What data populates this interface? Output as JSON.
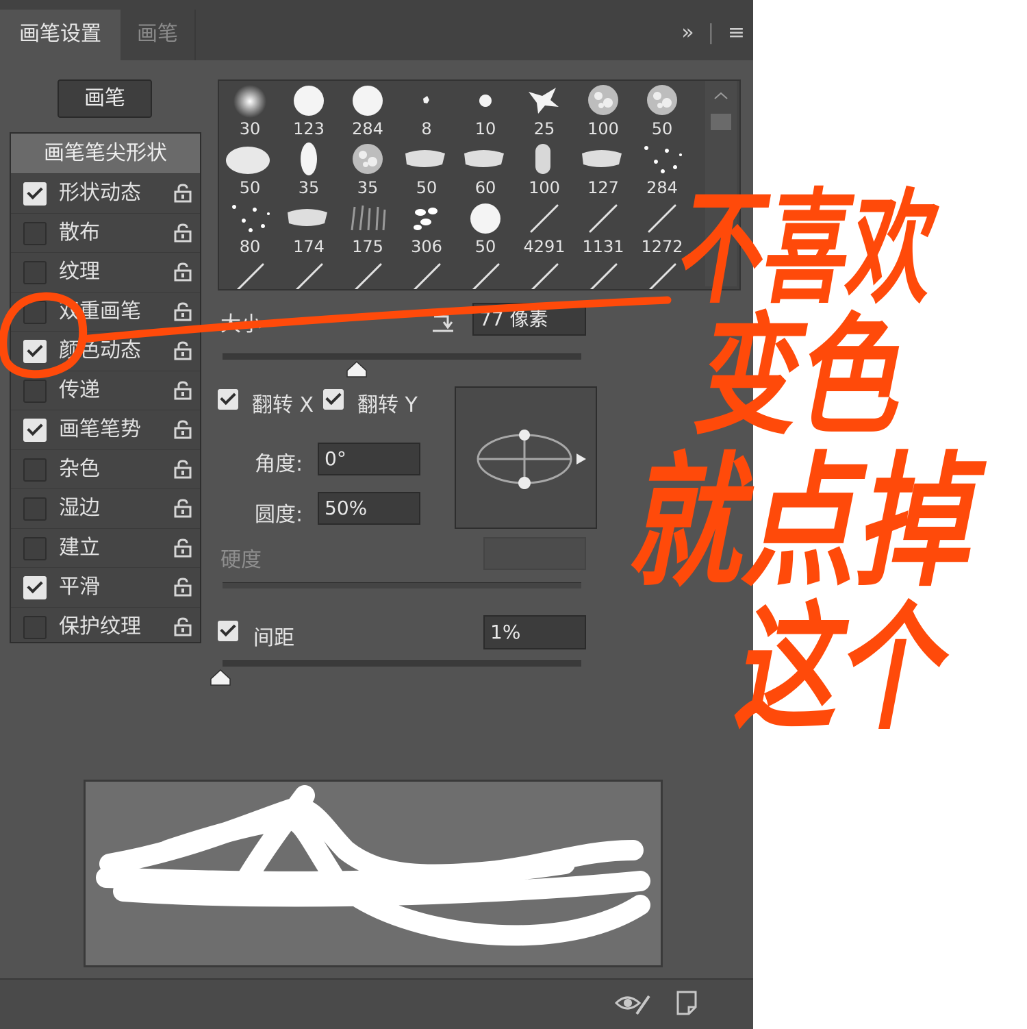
{
  "tabs": [
    {
      "label": "画笔设置",
      "active": true
    },
    {
      "label": "画笔",
      "active": false
    }
  ],
  "tab_actions": {
    "expand_icon": "double-chevron-right-icon",
    "menu_icon": "hamburger-menu-icon"
  },
  "brush_button": {
    "label": "画笔"
  },
  "options": {
    "header": "画笔笔尖形状",
    "items": [
      {
        "label": "形状动态",
        "checked": true
      },
      {
        "label": "散布",
        "checked": false
      },
      {
        "label": "纹理",
        "checked": false
      },
      {
        "label": "双重画笔",
        "checked": false
      },
      {
        "label": "颜色动态",
        "checked": true
      },
      {
        "label": "传递",
        "checked": false
      },
      {
        "label": "画笔笔势",
        "checked": true
      },
      {
        "label": "杂色",
        "checked": false
      },
      {
        "label": "湿边",
        "checked": false
      },
      {
        "label": "建立",
        "checked": false
      },
      {
        "label": "平滑",
        "checked": true
      },
      {
        "label": "保护纹理",
        "checked": false
      }
    ]
  },
  "presets": [
    {
      "size": "30",
      "shape": "soft-round"
    },
    {
      "size": "123",
      "shape": "hard-round"
    },
    {
      "size": "284",
      "shape": "hard-round"
    },
    {
      "size": "8",
      "shape": "splat"
    },
    {
      "size": "10",
      "shape": "dot"
    },
    {
      "size": "25",
      "shape": "spatter"
    },
    {
      "size": "100",
      "shape": "texture"
    },
    {
      "size": "50",
      "shape": "texture"
    },
    {
      "size": "50",
      "shape": "oval-texture"
    },
    {
      "size": "35",
      "shape": "leaf"
    },
    {
      "size": "35",
      "shape": "texture"
    },
    {
      "size": "50",
      "shape": "chalk"
    },
    {
      "size": "60",
      "shape": "chalk"
    },
    {
      "size": "100",
      "shape": "blade"
    },
    {
      "size": "127",
      "shape": "chalk"
    },
    {
      "size": "284",
      "shape": "scatter"
    },
    {
      "size": "80",
      "shape": "scatter"
    },
    {
      "size": "174",
      "shape": "chalk"
    },
    {
      "size": "175",
      "shape": "grass"
    },
    {
      "size": "306",
      "shape": "leaves"
    },
    {
      "size": "50",
      "shape": "hard-round"
    },
    {
      "size": "4291",
      "shape": "stroke"
    },
    {
      "size": "1131",
      "shape": "stroke"
    },
    {
      "size": "1272",
      "shape": "stroke"
    },
    {
      "size": "",
      "shape": "stroke"
    },
    {
      "size": "",
      "shape": "stroke"
    },
    {
      "size": "",
      "shape": "stroke"
    },
    {
      "size": "",
      "shape": "stroke"
    },
    {
      "size": "",
      "shape": "stroke"
    },
    {
      "size": "",
      "shape": "stroke"
    },
    {
      "size": "",
      "shape": "stroke"
    },
    {
      "size": "",
      "shape": "stroke"
    }
  ],
  "size": {
    "label": "大小",
    "value": "77 像素"
  },
  "flip": {
    "x_label": "翻转 X",
    "x_checked": true,
    "y_label": "翻转 Y",
    "y_checked": true
  },
  "angle": {
    "label": "角度:",
    "value": "0°"
  },
  "roundness": {
    "label": "圆度:",
    "value": "50%"
  },
  "hardness": {
    "label": "硬度",
    "value": ""
  },
  "spacing": {
    "label": "间距",
    "checked": true,
    "value": "1%"
  },
  "footer": {
    "icons": [
      "eye-brush-icon",
      "new-preset-icon"
    ]
  },
  "annotation": {
    "color": "#ff4a0a",
    "lines": [
      "不喜欢",
      "变色",
      "就点掉",
      "这个"
    ]
  }
}
